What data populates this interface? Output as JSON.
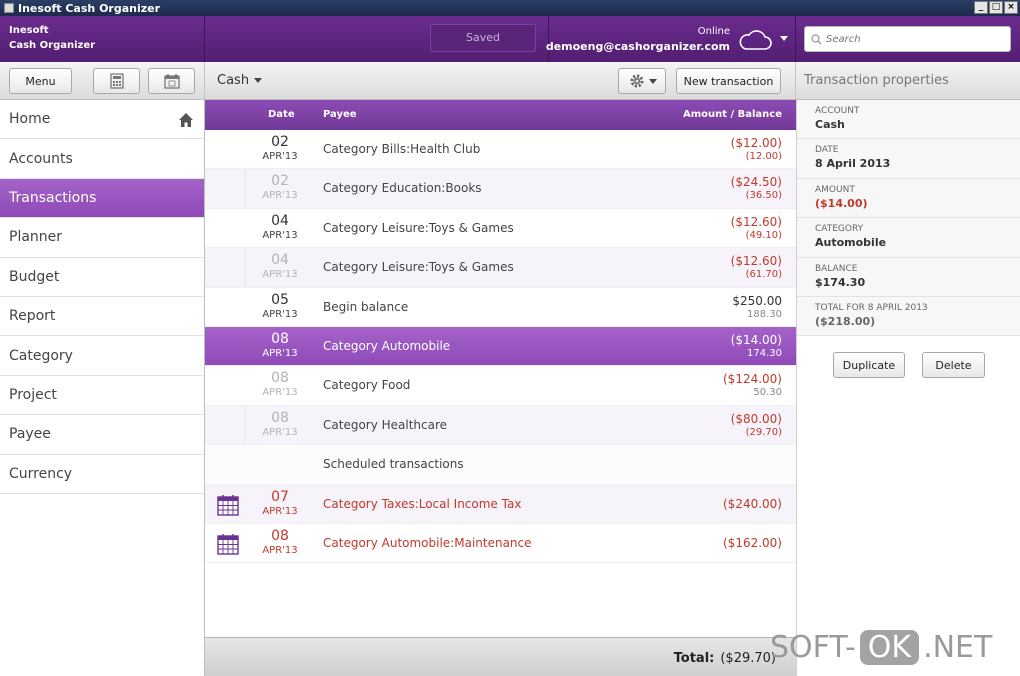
{
  "window": {
    "title": "Inesoft Cash Organizer"
  },
  "header": {
    "brand_line1": "Inesoft",
    "brand_line2": "Cash Organizer",
    "saved_label": "Saved",
    "online_label": "Online",
    "email": "demoeng@cashorganizer.com",
    "search_placeholder": "Search"
  },
  "toolbar": {
    "menu_label": "Menu",
    "account_selector": "Cash",
    "new_transaction_label": "New transaction",
    "properties_title": "Transaction properties"
  },
  "sidebar": {
    "items": [
      {
        "label": "Home"
      },
      {
        "label": "Accounts"
      },
      {
        "label": "Transactions"
      },
      {
        "label": "Planner"
      },
      {
        "label": "Budget"
      },
      {
        "label": "Report"
      },
      {
        "label": "Category"
      },
      {
        "label": "Project"
      },
      {
        "label": "Payee"
      },
      {
        "label": "Currency"
      }
    ]
  },
  "list": {
    "columns": {
      "date": "Date",
      "payee": "Payee",
      "amount": "Amount / Balance"
    },
    "rows": [
      {
        "day": "02",
        "month": "APR'13",
        "payee": "Category Bills:Health Club",
        "amount": "($12.00)",
        "balance": "(12.00)"
      },
      {
        "day": "02",
        "month": "APR'13",
        "payee": "Category Education:Books",
        "amount": "($24.50)",
        "balance": "(36.50)"
      },
      {
        "day": "04",
        "month": "APR'13",
        "payee": "Category Leisure:Toys & Games",
        "amount": "($12.60)",
        "balance": "(49.10)"
      },
      {
        "day": "04",
        "month": "APR'13",
        "payee": "Category Leisure:Toys & Games",
        "amount": "($12.60)",
        "balance": "(61.70)"
      },
      {
        "day": "05",
        "month": "APR'13",
        "payee": "Begin balance",
        "amount": "$250.00",
        "balance": "188.30"
      },
      {
        "day": "08",
        "month": "APR'13",
        "payee": "Category Automobile",
        "amount": "($14.00)",
        "balance": "174.30"
      },
      {
        "day": "08",
        "month": "APR'13",
        "payee": "Category Food",
        "amount": "($124.00)",
        "balance": "50.30"
      },
      {
        "day": "08",
        "month": "APR'13",
        "payee": "Category Healthcare",
        "amount": "($80.00)",
        "balance": "(29.70)"
      }
    ],
    "scheduled_header": "Scheduled transactions",
    "scheduled": [
      {
        "day": "07",
        "month": "APR'13",
        "payee": "Category Taxes:Local Income Tax",
        "amount": "($240.00)"
      },
      {
        "day": "08",
        "month": "APR'13",
        "payee": "Category Automobile:Maintenance",
        "amount": "($162.00)"
      }
    ],
    "total_label": "Total:",
    "total_value": "($29.70)"
  },
  "properties": {
    "account_label": "ACCOUNT",
    "account_value": "Cash",
    "date_label": "DATE",
    "date_value": "8 April 2013",
    "amount_label": "AMOUNT",
    "amount_value": "($14.00)",
    "category_label": "CATEGORY",
    "category_value": "Automobile",
    "balance_label": "BALANCE",
    "balance_value": "$174.30",
    "total_label": "TOTAL FOR 8 APRIL 2013",
    "total_value": "($218.00)",
    "duplicate_label": "Duplicate",
    "delete_label": "Delete"
  },
  "watermark": {
    "part1": "SOFT-",
    "part2": "OK",
    "part3": ".NET"
  },
  "colors": {
    "accent": "#8e49b6",
    "header": "#5c2280",
    "negative": "#c0392b"
  }
}
